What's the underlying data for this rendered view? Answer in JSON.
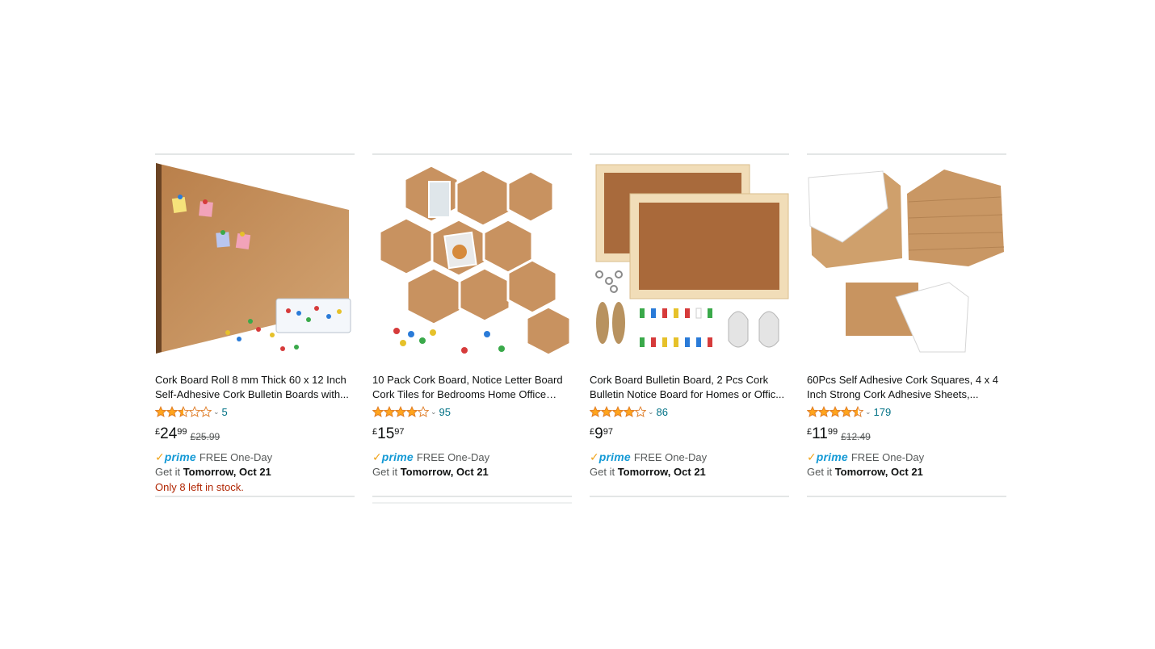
{
  "products": [
    {
      "image_icon": "cork-board-roll-image",
      "title": "Cork Board Roll 8 mm Thick 60 x 12 Inch Self-Adhesive Cork Bulletin Boards with...",
      "rating": 2.5,
      "review_count": "5",
      "price_symbol": "£",
      "price_whole": "24",
      "price_fraction": "99",
      "was_price": "£25.99",
      "prime_label": "prime",
      "shipping": "FREE One-Day",
      "delivery_prefix": "Get it",
      "delivery_date": "Tomorrow, Oct 21",
      "stock_note": "Only 8 left in stock."
    },
    {
      "image_icon": "hexagon-cork-tiles-image",
      "title": "10 Pack Cork Board, Notice Letter Board Cork Tiles for Bedrooms Home Office Sel...",
      "rating": 4.0,
      "review_count": "95",
      "price_symbol": "£",
      "price_whole": "15",
      "price_fraction": "97",
      "was_price": "",
      "prime_label": "prime",
      "shipping": "FREE One-Day",
      "delivery_prefix": "Get it",
      "delivery_date": "Tomorrow, Oct 21",
      "stock_note": ""
    },
    {
      "image_icon": "framed-cork-boards-image",
      "title": "Cork Board Bulletin Board, 2 Pcs Cork Bulletin Notice Board for Homes or Offic...",
      "rating": 4.0,
      "review_count": "86",
      "price_symbol": "£",
      "price_whole": "9",
      "price_fraction": "97",
      "was_price": "",
      "prime_label": "prime",
      "shipping": "FREE One-Day",
      "delivery_prefix": "Get it",
      "delivery_date": "Tomorrow, Oct 21",
      "stock_note": ""
    },
    {
      "image_icon": "cork-squares-image",
      "title": "60Pcs Self Adhesive Cork Squares, 4 x 4 Inch Strong Cork Adhesive Sheets,...",
      "rating": 4.5,
      "review_count": "179",
      "price_symbol": "£",
      "price_whole": "11",
      "price_fraction": "99",
      "was_price": "£12.49",
      "prime_label": "prime",
      "shipping": "FREE One-Day",
      "delivery_prefix": "Get it",
      "delivery_date": "Tomorrow, Oct 21",
      "stock_note": ""
    }
  ],
  "colors": {
    "star_fill": "#ffa41c",
    "link": "#007185",
    "prime_blue": "#1399d5",
    "prime_check": "#f0a41b",
    "stock_red": "#b12704",
    "cork": "#c8955f"
  }
}
